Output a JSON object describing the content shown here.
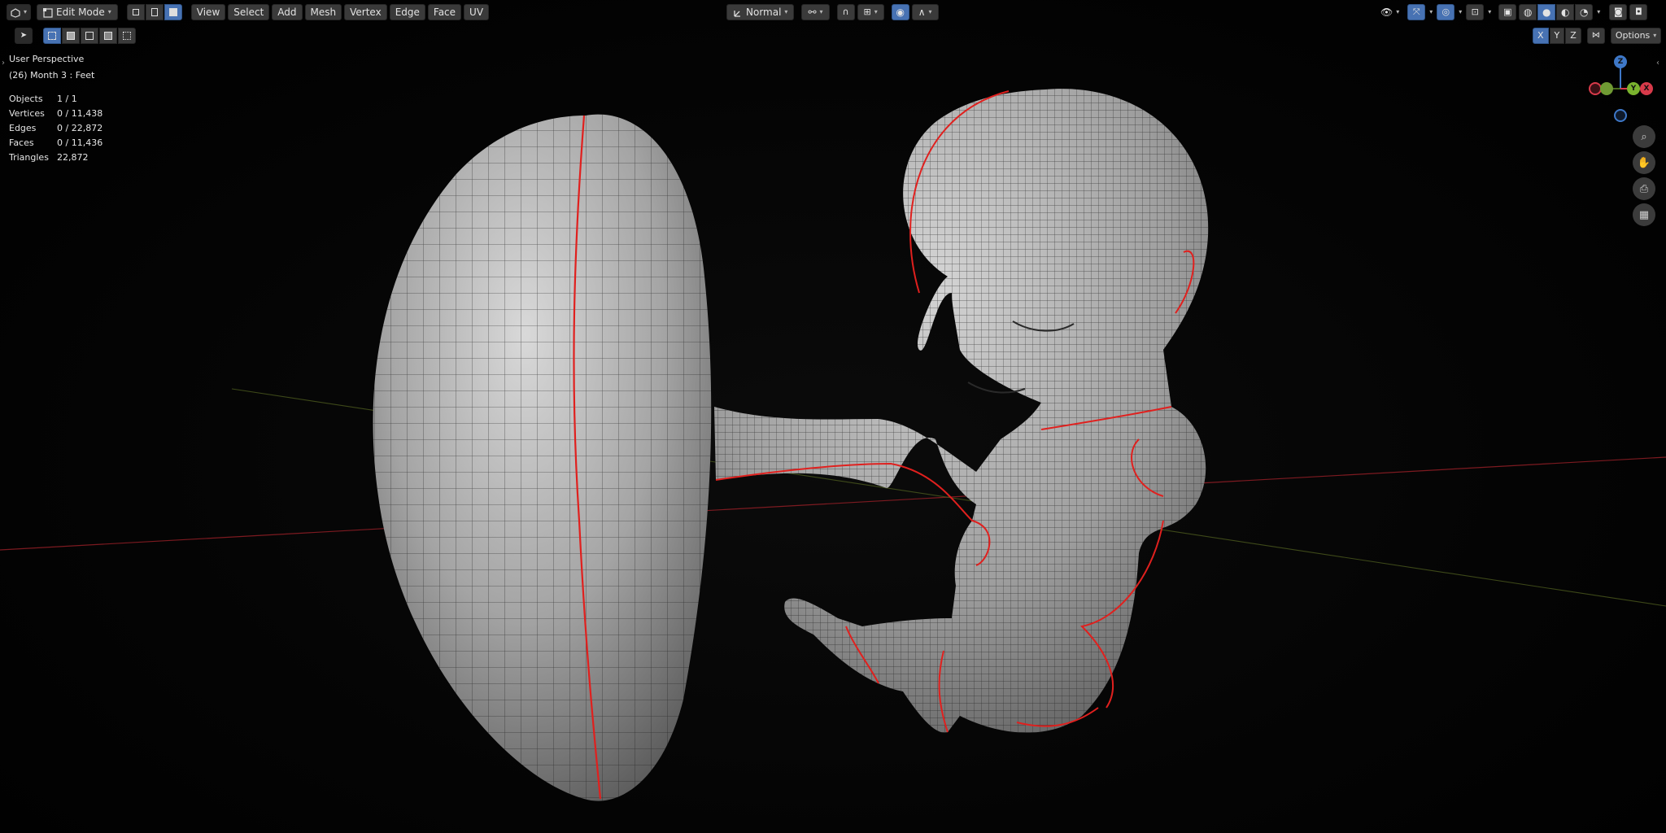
{
  "header": {
    "editor_type_icon": "3d-viewport-icon",
    "mode": "Edit Mode",
    "menus": [
      "View",
      "Select",
      "Add",
      "Mesh",
      "Vertex",
      "Edge",
      "Face",
      "UV"
    ],
    "transform_orientation": "Normal",
    "options_label": "Options",
    "axis_toggles": [
      "X",
      "Y",
      "Z"
    ]
  },
  "overlay": {
    "view_name": "User Perspective",
    "object_info": "(26) Month 3 : Feet",
    "stats": [
      {
        "label": "Objects",
        "value": "1 / 1"
      },
      {
        "label": "Vertices",
        "value": "0 / 11,438"
      },
      {
        "label": "Edges",
        "value": "0 / 22,872"
      },
      {
        "label": "Faces",
        "value": "0 / 11,436"
      },
      {
        "label": "Triangles",
        "value": "22,872"
      }
    ]
  },
  "gizmo": {
    "z_label": "Z",
    "y_label": "Y",
    "x_label": "X"
  },
  "colors": {
    "accent": "#4772b3",
    "seam": "#e0201e",
    "x_axis": "#d83a4a",
    "y_axis": "#7ab32e",
    "z_axis": "#3e78c8"
  }
}
